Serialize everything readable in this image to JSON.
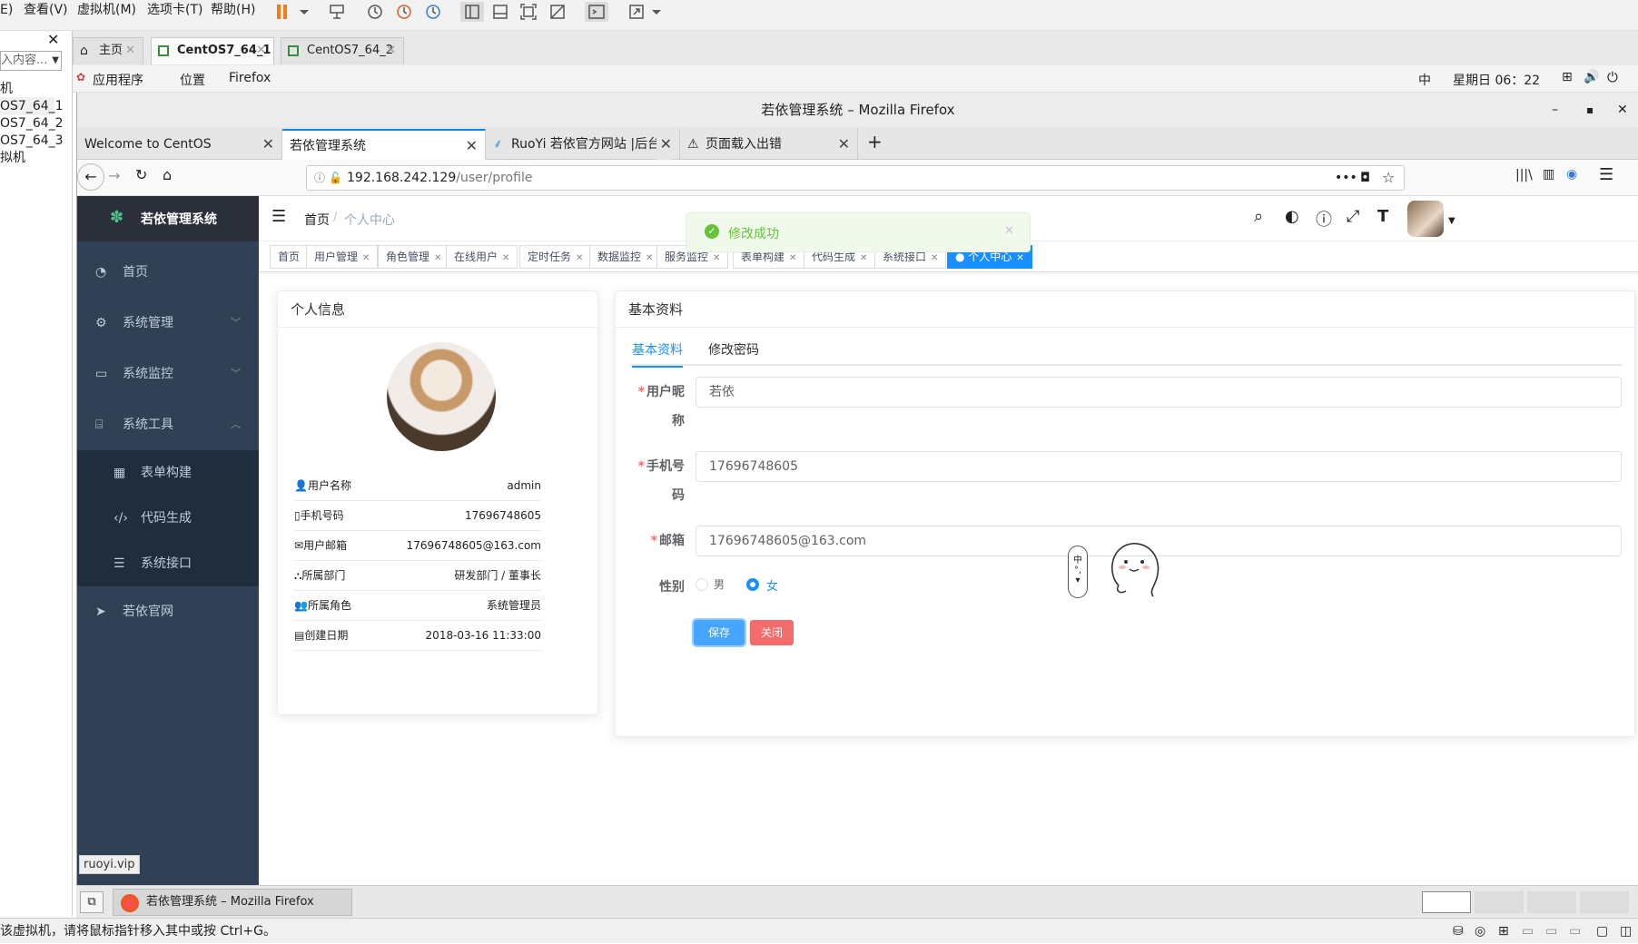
{
  "vm_menu": {
    "edit_fragment": "E)",
    "view": "查看(V)",
    "vm": "虚拟机(M)",
    "tabs": "选项卡(T)",
    "help": "帮助(H)"
  },
  "library": {
    "search_placeholder": "入内容...",
    "items": [
      "机",
      "OS7_64_1",
      "OS7_64_2",
      "OS7_64_3",
      "拟机"
    ]
  },
  "vm_tabs": [
    {
      "label": "主页"
    },
    {
      "label": "CentOS7_64_1"
    },
    {
      "label": "CentOS7_64_2"
    }
  ],
  "gnome": {
    "apps": "应用程序",
    "places": "位置",
    "firefox": "Firefox",
    "ime": "中",
    "clock": "星期日 06：22"
  },
  "firefox": {
    "title": "若依管理系统 – Mozilla Firefox",
    "tabs": [
      {
        "label": "Welcome to CentOS"
      },
      {
        "label": "若依管理系统"
      },
      {
        "label": "RuoYi 若依官方网站 |后台"
      },
      {
        "label": "页面载入出错"
      }
    ],
    "url_host": "192.168.242.129",
    "url_path": "/user/profile",
    "status_link": "ruoyi.vip"
  },
  "app": {
    "logo_title": "若依管理系统",
    "menu": {
      "home": "首页",
      "system": "系统管理",
      "monitor": "系统监控",
      "tools": "系统工具",
      "form_build": "表单构建",
      "code_gen": "代码生成",
      "sys_api": "系统接口",
      "website": "若依官网"
    },
    "breadcrumb": {
      "home": "首页",
      "current": "个人中心"
    },
    "toast": "修改成功",
    "tags": [
      "首页",
      "用户管理",
      "角色管理",
      "在线用户",
      "定时任务",
      "数据监控",
      "服务监控",
      "表单构建",
      "代码生成",
      "系统接口",
      "个人中心"
    ],
    "profile": {
      "title": "个人信息",
      "rows": [
        {
          "label": "用户名称",
          "value": "admin"
        },
        {
          "label": "手机号码",
          "value": "17696748605"
        },
        {
          "label": "用户邮箱",
          "value": "17696748605@163.com"
        },
        {
          "label": "所属部门",
          "value": "研发部门 / 董事长"
        },
        {
          "label": "所属角色",
          "value": "系统管理员"
        },
        {
          "label": "创建日期",
          "value": "2018-03-16 11:33:00"
        }
      ]
    },
    "basic": {
      "title": "基本资料",
      "tab_basic": "基本资料",
      "tab_password": "修改密码",
      "nickname_label_1": "用户昵",
      "nickname_label_2": "称",
      "nickname": "若依",
      "phone_label_1": "手机号",
      "phone_label_2": "码",
      "phone": "17696748605",
      "email_label": "邮箱",
      "email": "17696748605@163.com",
      "gender_label": "性别",
      "male": "男",
      "female": "女",
      "save": "保存",
      "close": "关闭"
    },
    "ime_char": "中"
  },
  "taskbar": {
    "window": "若依管理系统 – Mozilla Firefox"
  },
  "vm_status": "该虚拟机，请将鼠标指针移入其中或按 Ctrl+G。",
  "colors": {
    "sidebar": "#304156",
    "primary": "#1890ff",
    "danger": "#f56c6c",
    "success": "#67c23a"
  }
}
